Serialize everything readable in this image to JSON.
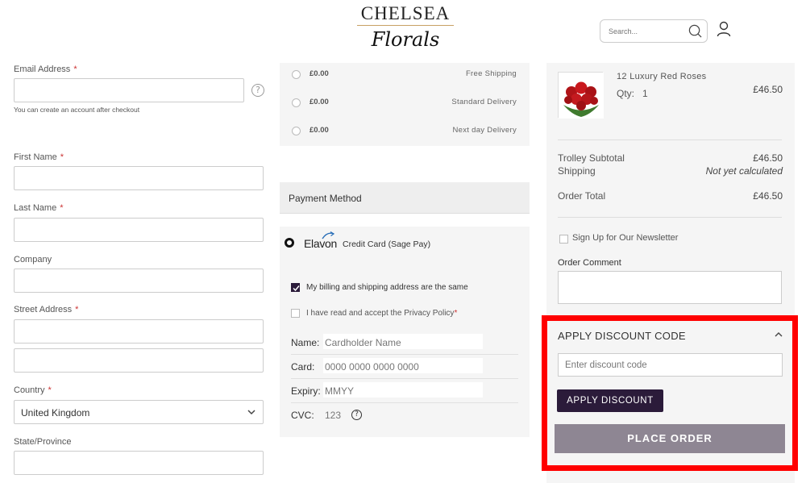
{
  "header": {
    "logo_top": "CHELSEA",
    "logo_bottom": "Florals",
    "search_placeholder": "Search..."
  },
  "left_form": {
    "email_label": "Email Address",
    "email_hint": "You can create an account after checkout",
    "first_name_label": "First Name",
    "last_name_label": "Last Name",
    "company_label": "Company",
    "street_label": "Street Address",
    "country_label": "Country",
    "country_value": "United Kingdom",
    "state_label": "State/Province",
    "required_mark": "*"
  },
  "shipping": {
    "options": [
      {
        "price": "£0.00",
        "name": "Free Shipping"
      },
      {
        "price": "£0.00",
        "name": "Standard Delivery"
      },
      {
        "price": "£0.00",
        "name": "Next day Delivery"
      }
    ]
  },
  "payment": {
    "header": "Payment Method",
    "provider": "Elavon",
    "method_label": "Credit Card (Sage Pay)",
    "same_address_label": "My billing and shipping address are the same",
    "privacy_label": "I have read and accept the Privacy Policy",
    "card_fields": [
      {
        "key": "Name:",
        "placeholder": "Cardholder Name"
      },
      {
        "key": "Card:",
        "placeholder": "0000 0000 0000 0000"
      },
      {
        "key": "Expiry:",
        "placeholder": "MMYY"
      },
      {
        "key": "CVC:",
        "placeholder": "123"
      }
    ]
  },
  "summary": {
    "product_name": "12 Luxury Red Roses",
    "qty_label": "Qty:",
    "qty_value": "1",
    "product_price": "£46.50",
    "subtotal_label": "Trolley Subtotal",
    "subtotal_value": "£46.50",
    "shipping_label": "Shipping",
    "shipping_value": "Not yet calculated",
    "total_label": "Order Total",
    "total_value": "£46.50",
    "newsletter_label": "Sign Up for Our Newsletter",
    "comment_label": "Order Comment",
    "discount_title": "APPLY DISCOUNT CODE",
    "discount_placeholder": "Enter discount code",
    "apply_label": "APPLY DISCOUNT",
    "place_order_label": "PLACE ORDER"
  },
  "colors": {
    "accent_dark": "#2b1b3a",
    "place_order_bg": "#8e8693",
    "highlight": "#ff0000"
  }
}
